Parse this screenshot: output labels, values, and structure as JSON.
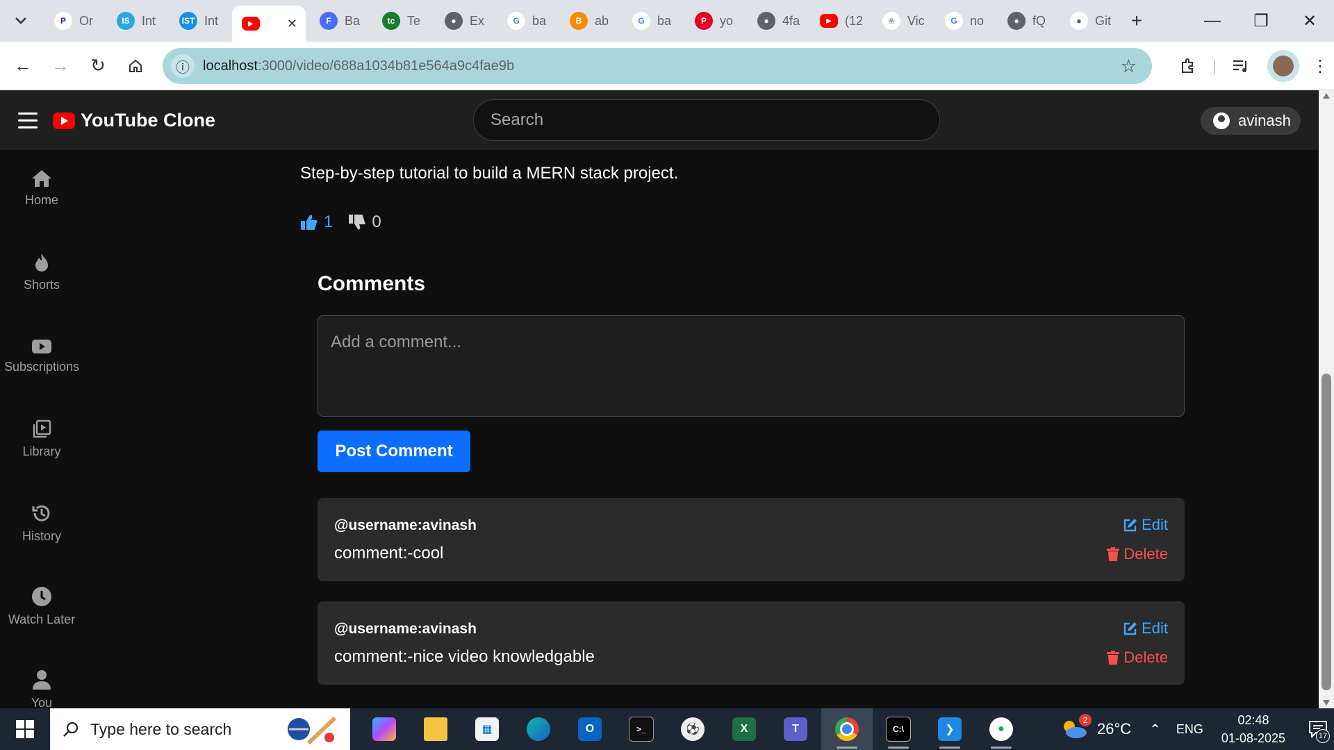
{
  "browser": {
    "tabs": [
      {
        "icon": "perplexity-icon",
        "label": "Or",
        "color": "#ffffff",
        "fg": "#3d2a8a"
      },
      {
        "icon": "internshala-icon",
        "label": "Int",
        "color": "#2aa8e0",
        "fg": "#ffffff"
      },
      {
        "icon": "ist-icon",
        "label": "Int",
        "color": "#1a8fe3",
        "fg": "#ffffff"
      },
      {
        "icon": "youtube-icon",
        "label": "",
        "color": "#ff0000",
        "fg": "#ffffff",
        "active": true
      },
      {
        "icon": "forms-icon",
        "label": "Ba",
        "color": "#4a6cf7",
        "fg": "#ffffff"
      },
      {
        "icon": "tc-icon",
        "label": "Te",
        "color": "#1b7d2b",
        "fg": "#ffffff"
      },
      {
        "icon": "globe-icon",
        "label": "Ex",
        "color": "#5f6368",
        "fg": "#ffffff"
      },
      {
        "icon": "google-icon",
        "label": "ba",
        "color": "#ffffff",
        "fg": "#4285f4"
      },
      {
        "icon": "brave-icon",
        "label": "ab",
        "color": "#fb8c00",
        "fg": "#ffffff"
      },
      {
        "icon": "google-icon",
        "label": "ba",
        "color": "#ffffff",
        "fg": "#4285f4"
      },
      {
        "icon": "pinterest-icon",
        "label": "yo",
        "color": "#e60023",
        "fg": "#ffffff"
      },
      {
        "icon": "globe-icon",
        "label": "4fa",
        "color": "#5f6368",
        "fg": "#ffffff"
      },
      {
        "icon": "youtube-icon",
        "label": "(12",
        "color": "#ff0000",
        "fg": "#ffffff"
      },
      {
        "icon": "openai-icon",
        "label": "Vic",
        "color": "#ffffff",
        "fg": "#999999"
      },
      {
        "icon": "google-icon",
        "label": "no",
        "color": "#ffffff",
        "fg": "#4285f4"
      },
      {
        "icon": "globe-icon",
        "label": "fQ",
        "color": "#5f6368",
        "fg": "#ffffff"
      },
      {
        "icon": "github-icon",
        "label": "Git",
        "color": "#ffffff",
        "fg": "#555555"
      }
    ],
    "url_host": "localhost",
    "url_path": ":3000/video/688a1034b81e564a9c4fae9b"
  },
  "header": {
    "brand": "YouTube Clone",
    "search_placeholder": "Search",
    "username": "avinash"
  },
  "sidebar": {
    "items": [
      {
        "label": "Home",
        "icon": "home-icon"
      },
      {
        "label": "Shorts",
        "icon": "fire-icon"
      },
      {
        "label": "Subscriptions",
        "icon": "video-icon"
      },
      {
        "label": "Library",
        "icon": "library-icon"
      },
      {
        "label": "History",
        "icon": "history-icon"
      },
      {
        "label": "Watch Later",
        "icon": "clock-icon"
      },
      {
        "label": "You",
        "icon": "user-icon"
      }
    ]
  },
  "video": {
    "description": "Step-by-step tutorial to build a MERN stack project.",
    "likes": "1",
    "dislikes": "0"
  },
  "comments": {
    "title": "Comments",
    "input_placeholder": "Add a comment...",
    "post_label": "Post Comment",
    "edit_label": "Edit",
    "delete_label": "Delete",
    "items": [
      {
        "user": "@username:avinash",
        "text": "comment:-cool"
      },
      {
        "user": "@username:avinash",
        "text": "comment:-nice video knowledgable"
      }
    ]
  },
  "taskbar": {
    "search_placeholder": "Type here to search",
    "apps": [
      "copilot-icon",
      "file-explorer-icon",
      "store-icon",
      "edge-icon",
      "outlook-icon",
      "terminal-icon",
      "soccer-icon",
      "excel-icon",
      "teams-icon",
      "chrome-icon",
      "cmd-icon",
      "vscode-icon",
      "mongodb-icon"
    ],
    "weather_temp": "26°C",
    "weather_badge": "2",
    "lang": "ENG",
    "time": "02:48",
    "date": "01-08-2025",
    "notif_count": "17"
  },
  "colors": {
    "accent_blue": "#0d6efd",
    "like_blue": "#3ea6ff",
    "delete_red": "#ff4d4d"
  }
}
